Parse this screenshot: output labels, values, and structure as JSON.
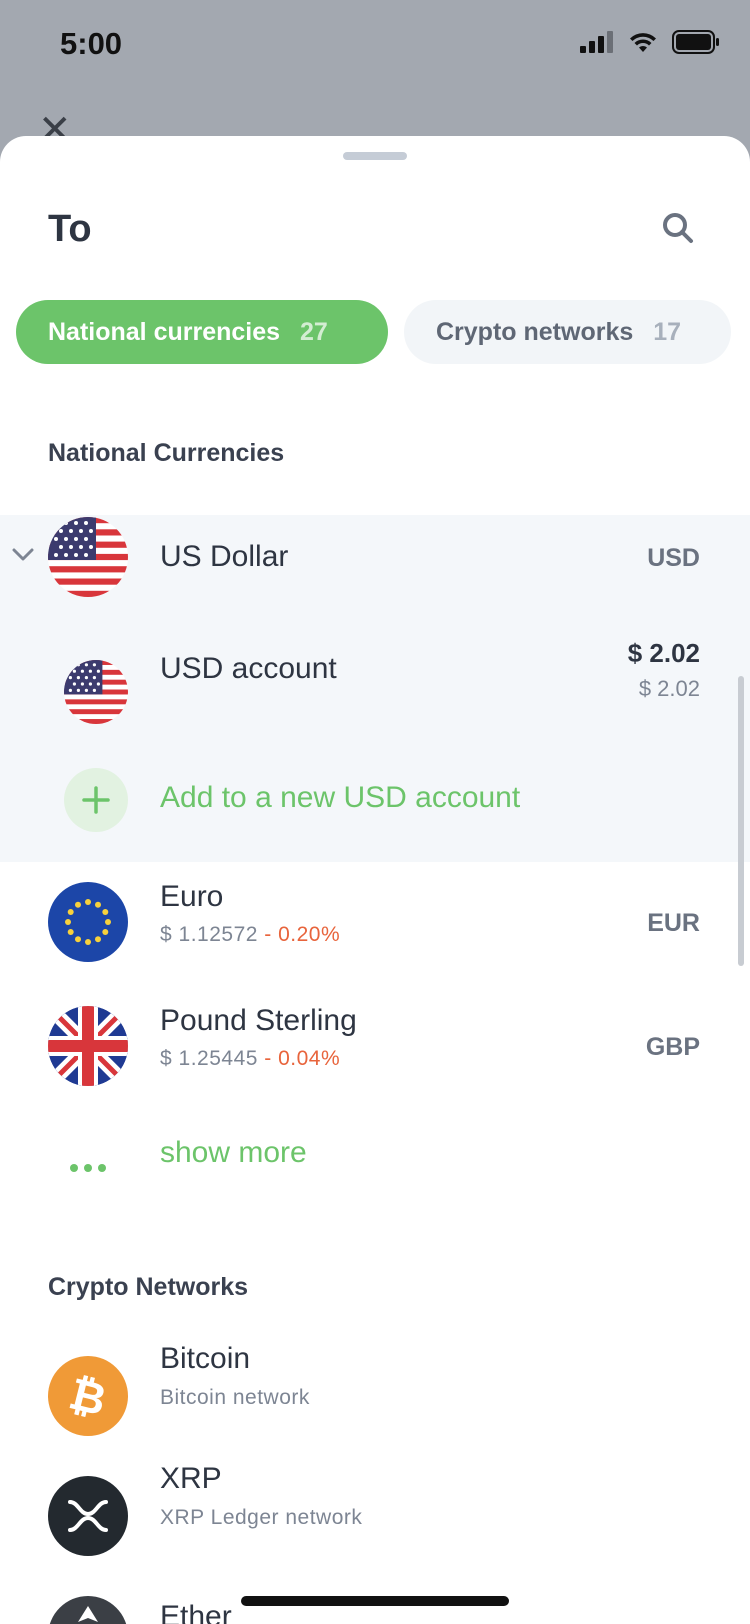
{
  "status_bar": {
    "time": "5:00"
  },
  "header": {
    "title": "To"
  },
  "tabs": [
    {
      "label": "National currencies",
      "count": "27",
      "active": true
    },
    {
      "label": "Crypto networks",
      "count": "17",
      "active": false
    }
  ],
  "sections": {
    "national_title": "National Currencies",
    "crypto_title": "Crypto Networks"
  },
  "usd": {
    "name": "US Dollar",
    "code": "USD",
    "account_name": "USD account",
    "balance": "$ 2.02",
    "balance_sub": "$ 2.02",
    "add_label": "Add to a new USD account"
  },
  "currencies": [
    {
      "name": "Euro",
      "rate": "$ 1.12572",
      "change": "- 0.20%",
      "code": "EUR"
    },
    {
      "name": "Pound Sterling",
      "rate": "$ 1.25445",
      "change": "- 0.04%",
      "code": "GBP"
    }
  ],
  "show_more": "show more",
  "crypto": [
    {
      "name": "Bitcoin",
      "network": "Bitcoin network",
      "icon": "bitcoin-icon"
    },
    {
      "name": "XRP",
      "network": "XRP Ledger network",
      "icon": "xrp-icon"
    },
    {
      "name": "Ether",
      "network": "",
      "icon": "ether-icon"
    }
  ],
  "colors": {
    "accent": "#6cc46a",
    "negative": "#e8643c",
    "bitcoin": "#f09a37",
    "xrp": "#23292f"
  }
}
